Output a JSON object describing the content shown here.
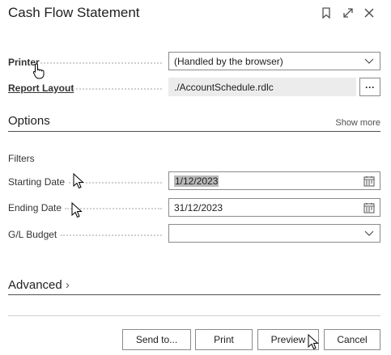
{
  "dialog": {
    "title": "Cash Flow Statement",
    "icons": [
      "bookmark-icon",
      "expand-icon",
      "close-icon"
    ]
  },
  "printer": {
    "label": "Printer",
    "value": "(Handled by the browser)"
  },
  "report_layout": {
    "label": "Report Layout",
    "value": "./AccountSchedule.rdlc",
    "more_label": "···"
  },
  "options": {
    "title": "Options",
    "show_more": "Show more"
  },
  "filters": {
    "title": "Filters",
    "starting_date": {
      "label": "Starting Date",
      "value": "1/12/2023"
    },
    "ending_date": {
      "label": "Ending Date",
      "value": "31/12/2023"
    },
    "gl_budget": {
      "label": "G/L Budget",
      "value": ""
    }
  },
  "advanced": {
    "title": "Advanced",
    "chevron": "›"
  },
  "footer": {
    "send_to": "Send to...",
    "print": "Print",
    "preview": "Preview",
    "cancel": "Cancel"
  }
}
